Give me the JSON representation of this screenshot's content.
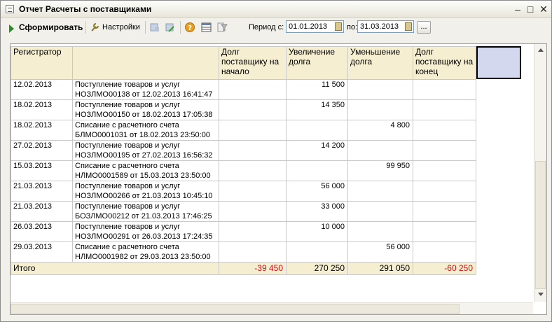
{
  "window": {
    "title": "Отчет  Расчеты с поставщиками",
    "icon": "report-icon",
    "controls": [
      "minimize-icon",
      "maximize-icon",
      "close-icon"
    ]
  },
  "toolbar": {
    "generate_label": "Сформировать",
    "settings_label": "Настройки",
    "period_label": "Период с:",
    "period_from": "01.01.2013",
    "to_label": "по:",
    "period_to": "31.03.2013",
    "select_period_label": "..."
  },
  "table": {
    "headers": {
      "registrar": "Регистратор",
      "document": "",
      "debt_start": "Долг поставщику на начало",
      "increase": "Увеличение долга",
      "decrease": "Уменьшение долга",
      "debt_end": "Долг поставщику на конец"
    },
    "rows": [
      {
        "date": "12.02.2013",
        "doc_line1": "Поступление товаров и услуг",
        "doc_line2": "НОЗЛМО00138 от 12.02.2013 16:41:47",
        "debt_start": "",
        "increase": "11 500",
        "decrease": "",
        "debt_end": ""
      },
      {
        "date": "18.02.2013",
        "doc_line1": "Поступление товаров и услуг",
        "doc_line2": "НОЗЛМО00150 от 18.02.2013 17:05:38",
        "debt_start": "",
        "increase": "14 350",
        "decrease": "",
        "debt_end": ""
      },
      {
        "date": "18.02.2013",
        "doc_line1": "Списание с расчетного счета",
        "doc_line2": "БЛМО0001031 от 18.02.2013 23:50:00",
        "debt_start": "",
        "increase": "",
        "decrease": "4 800",
        "debt_end": ""
      },
      {
        "date": "27.02.2013",
        "doc_line1": "Поступление товаров и услуг",
        "doc_line2": "НОЗЛМО00195 от 27.02.2013 16:56:32",
        "debt_start": "",
        "increase": "14 200",
        "decrease": "",
        "debt_end": ""
      },
      {
        "date": "15.03.2013",
        "doc_line1": "Списание с расчетного счета",
        "doc_line2": "НЛМО0001589 от 15.03.2013 23:50:00",
        "debt_start": "",
        "increase": "",
        "decrease": "99 950",
        "debt_end": ""
      },
      {
        "date": "21.03.2013",
        "doc_line1": "Поступление товаров и услуг",
        "doc_line2": "НОЗЛМО00266 от 21.03.2013 10:45:10",
        "debt_start": "",
        "increase": "56 000",
        "decrease": "",
        "debt_end": ""
      },
      {
        "date": "21.03.2013",
        "doc_line1": "Поступление товаров и услуг",
        "doc_line2": "БОЗЛМО00212 от 21.03.2013 17:46:25",
        "debt_start": "",
        "increase": "33 000",
        "decrease": "",
        "debt_end": ""
      },
      {
        "date": "26.03.2013",
        "doc_line1": "Поступление товаров и услуг",
        "doc_line2": "НОЗЛМО00291 от 26.03.2013 17:24:35",
        "debt_start": "",
        "increase": "10 000",
        "decrease": "",
        "debt_end": ""
      },
      {
        "date": "29.03.2013",
        "doc_line1": "Списание с расчетного счета",
        "doc_line2": "НЛМО0001982 от 29.03.2013 23:50:00",
        "debt_start": "",
        "increase": "",
        "decrease": "56 000",
        "debt_end": ""
      }
    ],
    "total": {
      "label": "Итого",
      "debt_start": "-39 450",
      "increase": "270 250",
      "decrease": "291 050",
      "debt_end": "-60 250"
    }
  },
  "colors": {
    "header_bg": "#f5eed0",
    "negative": "#d01010",
    "selection": "#d3d8ef"
  }
}
